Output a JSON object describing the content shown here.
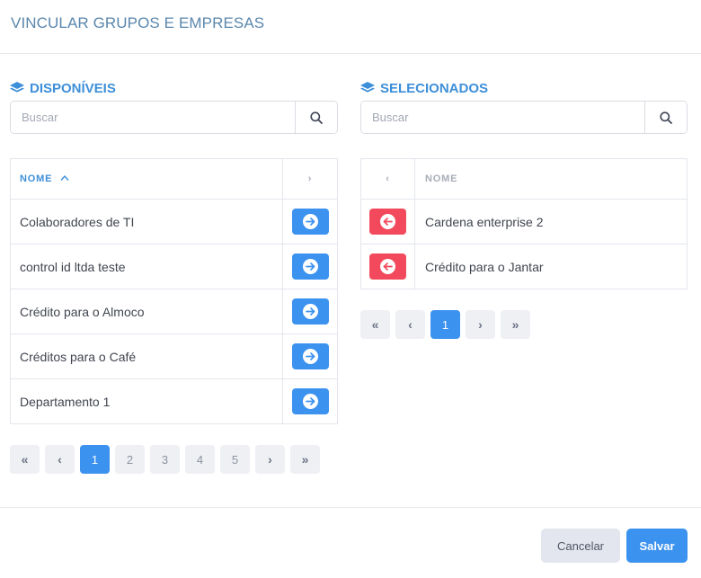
{
  "modal": {
    "title": "VINCULAR GRUPOS E EMPRESAS"
  },
  "available": {
    "title": "DISPONÍVEIS",
    "search_placeholder": "Buscar",
    "header_name": "NOME",
    "header_action": "›",
    "rows": [
      {
        "name": "Colaboradores de TI"
      },
      {
        "name": "control id ltda teste"
      },
      {
        "name": "Crédito para o Almoco"
      },
      {
        "name": "Créditos para o Café"
      },
      {
        "name": "Departamento 1"
      }
    ],
    "pagination": {
      "first": "«",
      "prev": "‹",
      "pages": [
        "1",
        "2",
        "3",
        "4",
        "5"
      ],
      "active": "1",
      "next": "›",
      "last": "»"
    }
  },
  "selected": {
    "title": "SELECIONADOS",
    "search_placeholder": "Buscar",
    "header_action": "‹",
    "header_name": "NOME",
    "rows": [
      {
        "name": "Cardena enterprise 2"
      },
      {
        "name": "Crédito para o Jantar"
      }
    ],
    "pagination": {
      "first": "«",
      "prev": "‹",
      "pages": [
        "1"
      ],
      "active": "1",
      "next": "›",
      "last": "»"
    }
  },
  "footer": {
    "cancel_label": "Cancelar",
    "save_label": "Salvar"
  },
  "icons": {
    "panel": "layers-icon",
    "search": "search-icon",
    "add": "arrow-circle-right-icon",
    "remove": "arrow-circle-left-icon",
    "sort": "sort-ascending-icon"
  },
  "colors": {
    "accent": "#3c92ef",
    "title": "#5a87ad",
    "remove": "#f24a5c"
  }
}
